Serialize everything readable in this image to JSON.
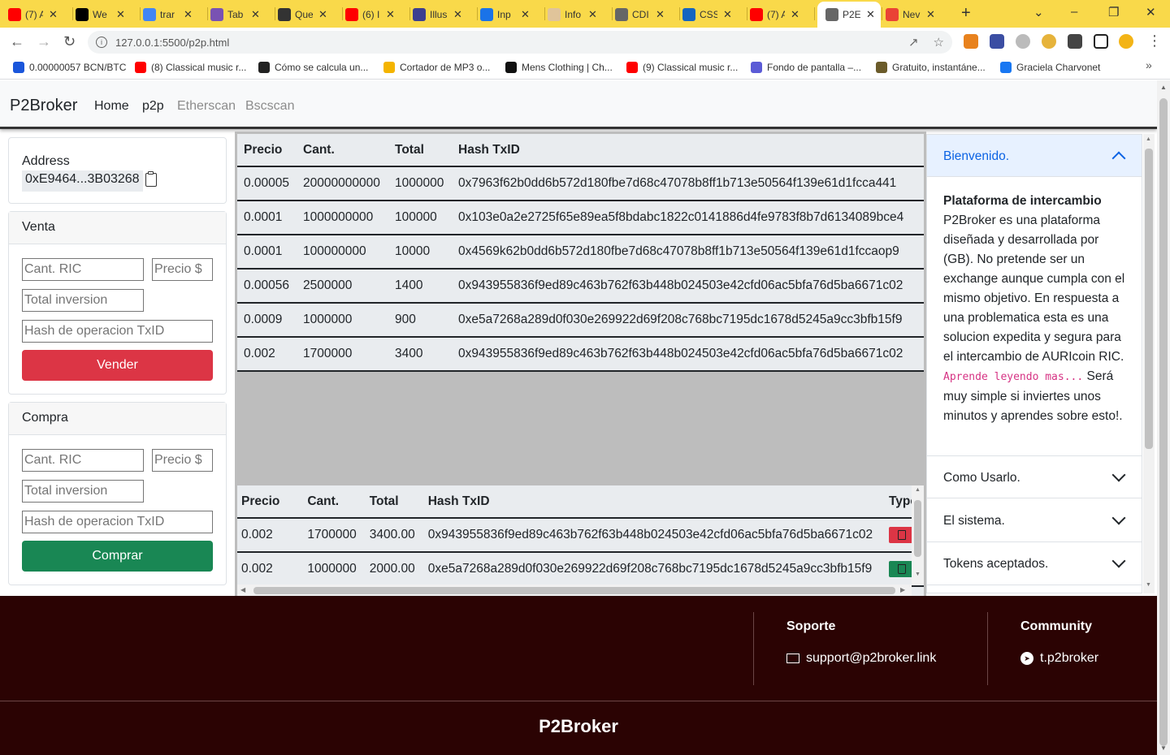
{
  "browser": {
    "tabs": [
      {
        "title": "(7) A",
        "color": "#ff0000"
      },
      {
        "title": "We",
        "color": "#000000"
      },
      {
        "title": "trar",
        "color": "#4285f4"
      },
      {
        "title": "Tab",
        "color": "#7952b3"
      },
      {
        "title": "Que",
        "color": "#333333"
      },
      {
        "title": "(6) I",
        "color": "#ff0000"
      },
      {
        "title": "Illus",
        "color": "#3c3f8f"
      },
      {
        "title": "Inp",
        "color": "#1a73e8"
      },
      {
        "title": "Info",
        "color": "#e0c49a"
      },
      {
        "title": "CDI",
        "color": "#666666"
      },
      {
        "title": "CSS",
        "color": "#1565c0"
      },
      {
        "title": "(7) A",
        "color": "#ff0000"
      },
      {
        "title": "P2E",
        "color": "#666666"
      },
      {
        "title": "Nev",
        "color": "#ea4335"
      }
    ],
    "url": "127.0.0.1:5500/p2p.html",
    "bookmarks": [
      {
        "label": "0.00000057 BCN/BTC",
        "color": "#1a56db"
      },
      {
        "label": "(8) Classical music r...",
        "color": "#ff0000"
      },
      {
        "label": "Cómo se calcula un...",
        "color": "#222222"
      },
      {
        "label": "Cortador de MP3 o...",
        "color": "#f4b400"
      },
      {
        "label": "Mens Clothing | Ch...",
        "color": "#111111"
      },
      {
        "label": "(9) Classical music r...",
        "color": "#ff0000"
      },
      {
        "label": "Fondo de pantalla –...",
        "color": "#5b5bd6"
      },
      {
        "label": "Gratuito, instantáne...",
        "color": "#6b5b2a"
      },
      {
        "label": "Graciela Charvonet",
        "color": "#1877f2"
      }
    ]
  },
  "nav": {
    "brand": "P2Broker",
    "links": [
      "Home",
      "p2p",
      "Etherscan",
      "Bscscan"
    ]
  },
  "wallet": {
    "address_label": "Address",
    "address_value": "0xE9464...3B03268"
  },
  "sell": {
    "title": "Venta",
    "qty_placeholder": "Cant. RIC",
    "price_placeholder": "Precio $",
    "total_placeholder": "Total inversion",
    "hash_placeholder": "Hash de operacion TxID",
    "button": "Vender"
  },
  "buy": {
    "title": "Compra",
    "qty_placeholder": "Cant. RIC",
    "price_placeholder": "Precio $",
    "total_placeholder": "Total inversion",
    "hash_placeholder": "Hash de operacion TxID",
    "button": "Comprar"
  },
  "orders": {
    "headers": [
      "Precio",
      "Cant.",
      "Total",
      "Hash TxID"
    ],
    "rows": [
      [
        "0.00005",
        "20000000000",
        "1000000",
        "0x7963f62b0dd6b572d180fbe7d68c47078b8ff1b713e50564f139e61d1fcca441"
      ],
      [
        "0.0001",
        "1000000000",
        "100000",
        "0x103e0a2e2725f65e89ea5f8bdabc1822c0141886d4fe9783f8b7d6134089bce4"
      ],
      [
        "0.0001",
        "100000000",
        "10000",
        "0x4569k62b0dd6b572d180fbe7d68c47078b8ff1b713e50564f139e61d1fccaop9"
      ],
      [
        "0.00056",
        "2500000",
        "1400",
        "0x943955836f9ed89c463b762f63b448b024503e42cfd06ac5bfa76d5ba6671c02"
      ],
      [
        "0.0009",
        "1000000",
        "900",
        "0xe5a7268a289d0f030e269922d69f208c768bc7195dc1678d5245a9cc3bfb15f9"
      ],
      [
        "0.002",
        "1700000",
        "3400",
        "0x943955836f9ed89c463b762f63b448b024503e42cfd06ac5bfa76d5ba6671c02"
      ]
    ]
  },
  "history": {
    "headers": [
      "Precio",
      "Cant.",
      "Total",
      "Hash TxID",
      "Type"
    ],
    "rows": [
      {
        "cells": [
          "0.002",
          "1700000",
          "3400.00",
          "0x943955836f9ed89c463b762f63b448b024503e42cfd06ac5bfa76d5ba6671c02"
        ],
        "type": "sell",
        "type_color": "#dc3545"
      },
      {
        "cells": [
          "0.002",
          "1000000",
          "2000.00",
          "0xe5a7268a289d0f030e269922d69f208c768bc7195dc1678d5245a9cc3bfb15f9"
        ],
        "type": "buy",
        "type_color": "#198754"
      }
    ]
  },
  "accordion": {
    "open_title": "Bienvenido.",
    "body_heading": "Plataforma de intercambio",
    "body_text": "P2Broker es una plataforma diseñada y desarrollada por (GB). No pretende ser un exchange aunque cumpla con el mismo objetivo. En respuesta a una problematica esta es una solucion expedita y segura para el intercambio de AURIcoin RIC.",
    "body_code": "Aprende leyendo mas...",
    "body_tail": " Será muy simple si inviertes unos minutos y aprendes sobre esto!.",
    "items": [
      "Como Usarlo.",
      "El sistema.",
      "Tokens aceptados."
    ]
  },
  "footer": {
    "support_title": "Soporte",
    "support_email": "support@p2broker.link",
    "community_title": "Community",
    "community_link": "t.p2broker",
    "brand": "P2Broker"
  },
  "colors": {
    "danger": "#dc3545",
    "success": "#198754",
    "footer_bg": "#2b0303",
    "browser_frame": "#f9d94a"
  }
}
